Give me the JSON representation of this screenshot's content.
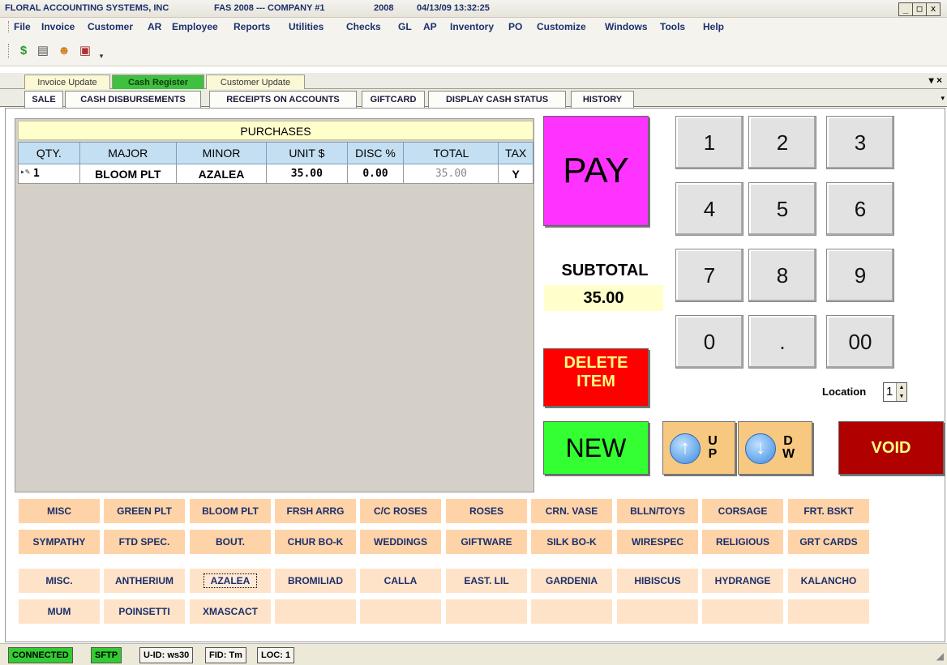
{
  "titlebar": {
    "company": "FLORAL ACCOUNTING SYSTEMS, INC",
    "product": "FAS 2008 --- COMPANY #1",
    "year": "2008",
    "datetime": "04/13/09 13:32:25",
    "min": "_",
    "max": "□",
    "close": "x"
  },
  "menu": [
    "File",
    "Invoice",
    "Customer",
    "AR",
    "Employee",
    "Reports",
    "Utilities",
    "Checks",
    "GL",
    "AP",
    "Inventory",
    "PO",
    "Customize",
    "Windows",
    "Tools",
    "Help"
  ],
  "toolbar_icons": [
    "dollar-icon",
    "register-icon",
    "customer-icon",
    "chart-icon",
    "overflow-icon"
  ],
  "window_tabs": [
    "Invoice Update",
    "Cash Register",
    "Customer Update"
  ],
  "window_tabs_active": "Cash Register",
  "sub_tabs": [
    "SALE",
    "CASH DISBURSEMENTS",
    "RECEIPTS ON ACCOUNTS",
    "GIFTCARD",
    "DISPLAY CASH STATUS",
    "HISTORY"
  ],
  "purchases": {
    "title": "PURCHASES",
    "columns": [
      "QTY.",
      "MAJOR",
      "MINOR",
      "UNIT $",
      "DISC %",
      "TOTAL",
      "TAX"
    ],
    "rows": [
      {
        "qty": "1",
        "major": "BLOOM PLT",
        "minor": "AZALEA",
        "unit": "35.00",
        "disc": "0.00",
        "total": "35.00",
        "tax": "Y"
      }
    ]
  },
  "pay_label": "PAY",
  "subtotal_label": "SUBTOTAL",
  "subtotal_value": "35.00",
  "delete_label_1": "DELETE",
  "delete_label_2": "ITEM",
  "new_label": "NEW",
  "void_label": "VOID",
  "up_label": [
    "U",
    "P"
  ],
  "down_label": [
    "D",
    "W"
  ],
  "keypad": [
    "1",
    "2",
    "3",
    "4",
    "5",
    "6",
    "7",
    "8",
    "9",
    "0",
    ".",
    "00"
  ],
  "location_label": "Location",
  "location_value": "1",
  "majors_row1": [
    "MISC",
    "GREEN PLT",
    "BLOOM PLT",
    "FRSH ARRG",
    "C/C ROSES",
    "ROSES",
    "CRN. VASE",
    "BLLN/TOYS",
    "CORSAGE",
    "FRT. BSKT"
  ],
  "majors_row2": [
    "SYMPATHY",
    "FTD SPEC.",
    "BOUT.",
    "CHUR BO-K",
    "WEDDINGS",
    "GIFTWARE",
    "SILK BO-K",
    "WIRESPEC",
    "RELIGIOUS",
    "GRT CARDS"
  ],
  "minors_row1": [
    "MISC.",
    "ANTHERIUM",
    "AZALEA",
    "BROMILIAD",
    "CALLA",
    "EAST. LIL",
    "GARDENIA",
    "HIBISCUS",
    "HYDRANGE",
    "KALANCHO"
  ],
  "minors_row2": [
    "MUM",
    "POINSETTI",
    "XMASCACT",
    "",
    "",
    "",
    "",
    "",
    "",
    ""
  ],
  "status": {
    "connected": "CONNECTED",
    "sftp": "SFTP",
    "uid": "U-ID: ws30",
    "fid": "FID: Tm",
    "loc": "LOC: 1"
  },
  "colors": {
    "pay": "#ff33ff",
    "delete": "#ff0000",
    "new": "#33ff33",
    "void": "#b00000",
    "category": "#ffd3a8",
    "active_tab": "#40c040"
  }
}
